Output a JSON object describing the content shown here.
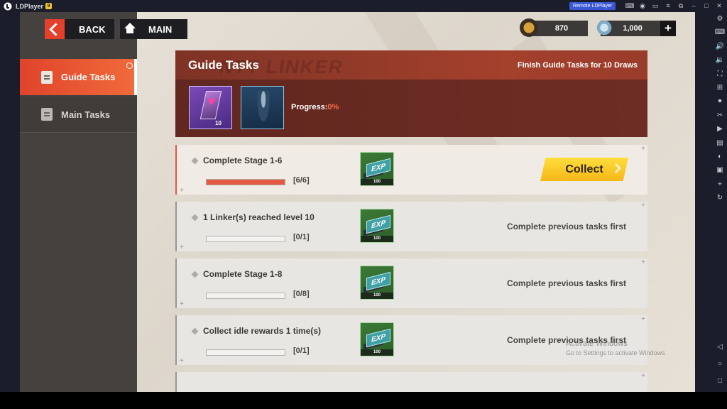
{
  "emulator": {
    "app_name": "LDPlayer",
    "version_badge": "9",
    "remote_button": "Remote LDPlayer"
  },
  "nav": {
    "back_label": "BACK",
    "main_label": "MAIN",
    "items": [
      {
        "label": "Guide Tasks",
        "active": true
      },
      {
        "label": "Main Tasks",
        "active": false
      }
    ]
  },
  "currency": {
    "primary": "870",
    "secondary": "1,000",
    "add_label": "+"
  },
  "header": {
    "title": "Guide Tasks",
    "watermark": "NTT LINKER",
    "subtitle": "Finish Guide Tasks for 10 Draws",
    "reward_ticket_count": "10",
    "progress_label": "Progress:",
    "progress_value": "0%"
  },
  "tasks": [
    {
      "title": "Complete Stage 1-6",
      "count": "[6/6]",
      "progress_fraction": 1.0,
      "reward_label": "EXP",
      "reward_count": "100",
      "action": "Collect",
      "state": "collectable"
    },
    {
      "title": "1 Linker(s) reached level 10",
      "count": "[0/1]",
      "progress_fraction": 0.0,
      "reward_label": "EXP",
      "reward_count": "100",
      "status": "Complete previous tasks first",
      "state": "locked"
    },
    {
      "title": "Complete Stage 1-8",
      "count": "[0/8]",
      "progress_fraction": 0.0,
      "reward_label": "EXP",
      "reward_count": "100",
      "status": "Complete previous tasks first",
      "state": "locked"
    },
    {
      "title": "Collect idle rewards 1 time(s)",
      "count": "[0/1]",
      "progress_fraction": 0.0,
      "reward_label": "EXP",
      "reward_count": "100",
      "status": "Complete previous tasks first",
      "state": "locked"
    }
  ],
  "os_watermark": {
    "title": "Activate Windows",
    "subtitle": "Go to Settings to activate Windows"
  },
  "colors": {
    "accent_red": "#e4402c",
    "collect_yellow": "#ffd23a",
    "header_brown": "#6e2c22"
  }
}
